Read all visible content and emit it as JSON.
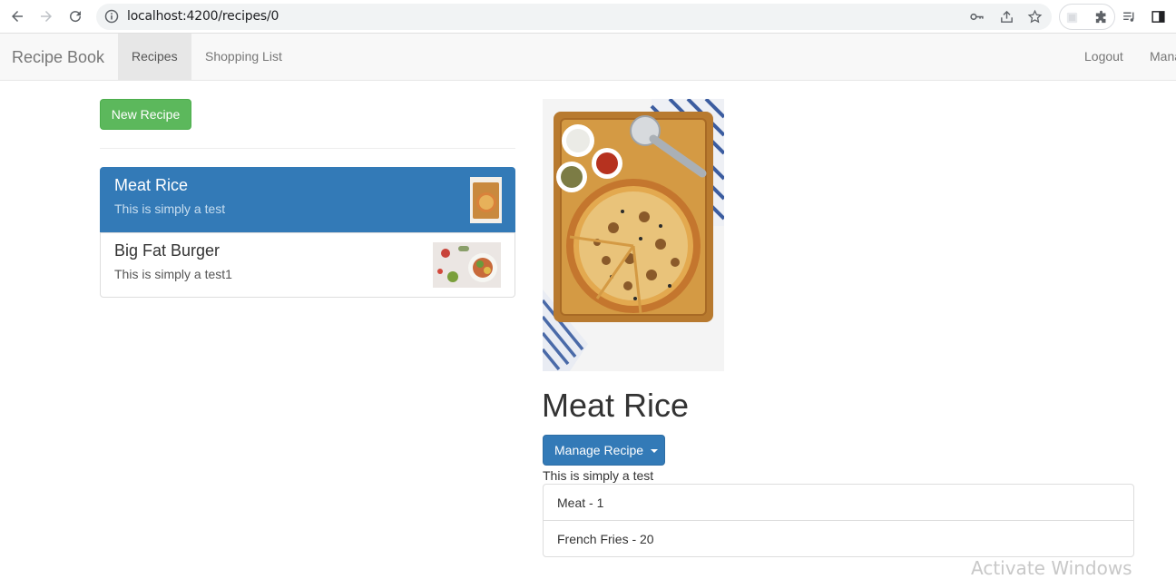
{
  "browser": {
    "url": "localhost:4200/recipes/0",
    "icons": [
      "back-icon",
      "forward-icon",
      "reload-icon",
      "info-icon",
      "key-icon",
      "share-icon",
      "star-icon",
      "extension-icon",
      "puzzle-icon",
      "media-icon",
      "sidepanel-icon"
    ]
  },
  "navbar": {
    "brand": "Recipe Book",
    "items": [
      {
        "label": "Recipes",
        "active": true
      },
      {
        "label": "Shopping List",
        "active": false
      }
    ],
    "right_items": [
      {
        "label": "Logout"
      },
      {
        "label": "Mana"
      }
    ]
  },
  "recipes_panel": {
    "new_button_label": "New Recipe",
    "items": [
      {
        "name": "Meat Rice",
        "description": "This is simply a test",
        "active": true
      },
      {
        "name": "Big Fat Burger",
        "description": "This is simply a test1",
        "active": false
      }
    ]
  },
  "detail": {
    "title": "Meat Rice",
    "manage_label": "Manage Recipe",
    "description": "This is simply a test",
    "ingredients": [
      {
        "text": "Meat - 1"
      },
      {
        "text": "French Fries - 20"
      }
    ]
  },
  "watermark": "Activate Windows",
  "colors": {
    "primary": "#337ab7",
    "success": "#5cb85c",
    "navbar_bg": "#f8f8f8"
  }
}
